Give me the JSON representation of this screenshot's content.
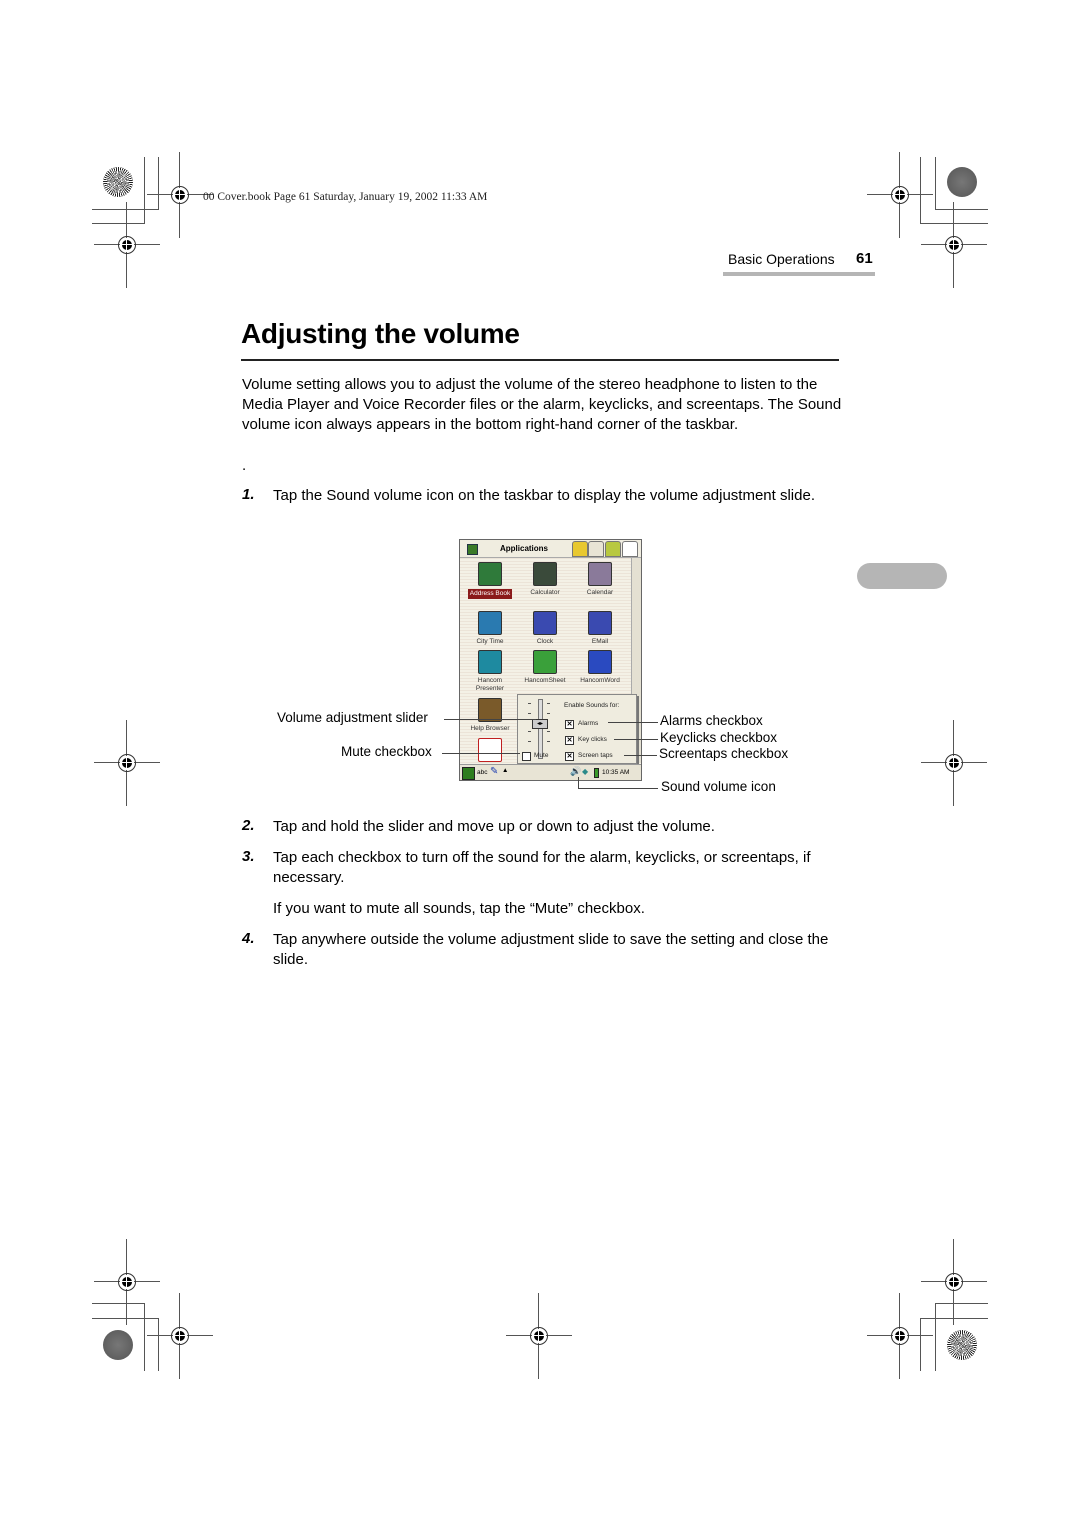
{
  "slug_line": "00 Cover.book  Page 61  Saturday, January 19, 2002  11:33 AM",
  "running_header": {
    "section": "Basic Operations",
    "page_number": "61"
  },
  "title": "Adjusting the volume",
  "intro": "Volume setting allows you to adjust the volume of the stereo headphone to listen to the Media Player and Voice Recorder files or the alarm, keyclicks, and screentaps. The Sound volume icon always appears in the bottom right-hand corner of the taskbar.",
  "stray_period": ".",
  "steps": [
    {
      "num": "1.",
      "text": "Tap the Sound volume icon on the taskbar to display the volume adjustment slide."
    },
    {
      "num": "2.",
      "text": "Tap and hold the slider and move up or down to adjust the volume."
    },
    {
      "num": "3.",
      "text": "Tap each checkbox to turn off the sound for the alarm, keyclicks, or screentaps, if necessary."
    },
    {
      "num": "4.",
      "text": "Tap anywhere outside the volume adjustment slide to save the setting and close the slide."
    }
  ],
  "step3_note": "If you want to mute all sounds, tap the “Mute” checkbox.",
  "screenshot": {
    "window_title": "Applications",
    "apps": [
      {
        "label": "Address Book",
        "icon": "at-sign-icon",
        "color": "#2f7a3a",
        "selected": true
      },
      {
        "label": "Calculator",
        "icon": "calculator-icon",
        "color": "#3a4a3a"
      },
      {
        "label": "Calendar",
        "icon": "calendar-icon",
        "color": "#8a7a9a"
      },
      {
        "label": "City Time",
        "icon": "globe-icon",
        "color": "#2a7ab0"
      },
      {
        "label": "Clock",
        "icon": "clock-icon",
        "color": "#3a4ab0"
      },
      {
        "label": "EMail",
        "icon": "envelope-icon",
        "color": "#3a4ab0"
      },
      {
        "label": "Hancom Presenter",
        "icon": "presenter-icon",
        "color": "#1e8aa0"
      },
      {
        "label": "HancomSheet",
        "icon": "sheet-icon",
        "color": "#3aa03a"
      },
      {
        "label": "HancomWord",
        "icon": "word-icon",
        "color": "#2a4ac0"
      },
      {
        "label": "Help Browser",
        "icon": "help-icon",
        "color": "#7a5a2a"
      },
      {
        "label": "",
        "icon": "opera-icon",
        "color": "#c02020"
      }
    ],
    "volume_panel": {
      "heading": "Enable Sounds for:",
      "volume_level": 0.6,
      "mute_label": "Mute",
      "mute_checked": false,
      "checkboxes": [
        {
          "label": "Alarms",
          "checked": true
        },
        {
          "label": "Key clicks",
          "checked": true
        },
        {
          "label": "Screen taps",
          "checked": true
        }
      ]
    },
    "taskbar": {
      "input_mode": "abc",
      "clock": "10:35 AM"
    }
  },
  "callouts": {
    "volume_slider": "Volume adjustment slider",
    "mute": "Mute checkbox",
    "alarms": "Alarms checkbox",
    "keyclicks": "Keyclicks checkbox",
    "screentaps": "Screentaps checkbox",
    "sound_icon": "Sound volume icon"
  }
}
